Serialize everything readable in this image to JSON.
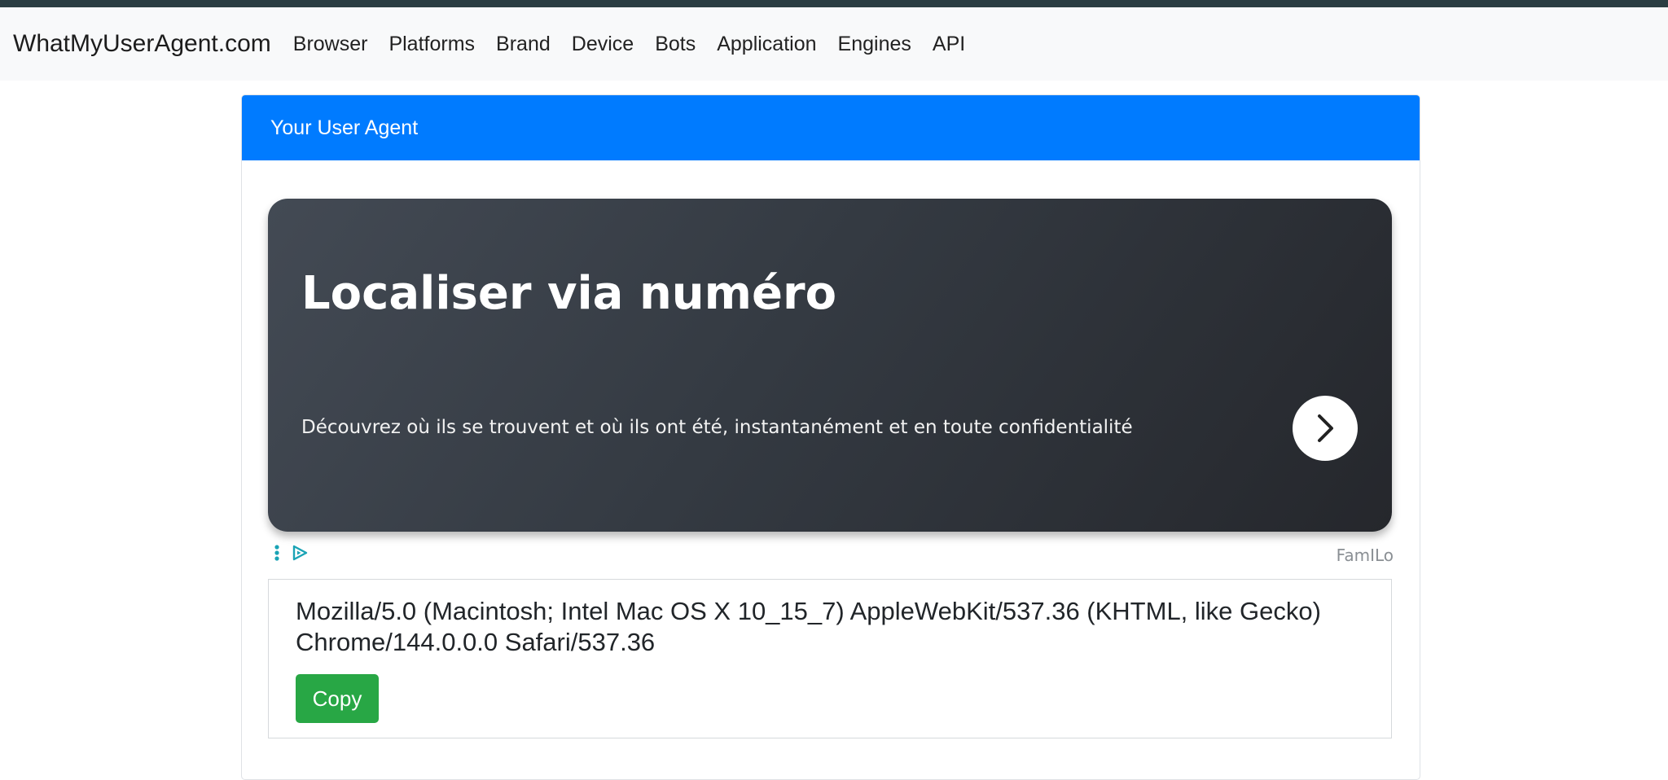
{
  "navbar": {
    "brand": "WhatMyUserAgent.com",
    "links": [
      "Browser",
      "Platforms",
      "Brand",
      "Device",
      "Bots",
      "Application",
      "Engines",
      "API"
    ]
  },
  "card": {
    "header": "Your User Agent"
  },
  "ad": {
    "title": "Localiser via numéro",
    "description": "Découvrez où ils se trouvent et où ils ont été, instantanément et en toute confidentialité",
    "sponsor": "FamILo",
    "arrow_icon": "chevron-right-icon",
    "options_icon": "vertical-dots-icon",
    "adchoices_icon": "play-triangle-icon",
    "accent_color": "#1aa3b5"
  },
  "user_agent": {
    "text": "Mozilla/5.0 (Macintosh; Intel Mac OS X 10_15_7) AppleWebKit/537.36 (KHTML, like Gecko) Chrome/144.0.0.0 Safari/537.36",
    "copy_label": "Copy"
  },
  "colors": {
    "header_blue": "#007bff",
    "copy_green": "#28a745",
    "navbar_bg": "#f8f9fa"
  }
}
